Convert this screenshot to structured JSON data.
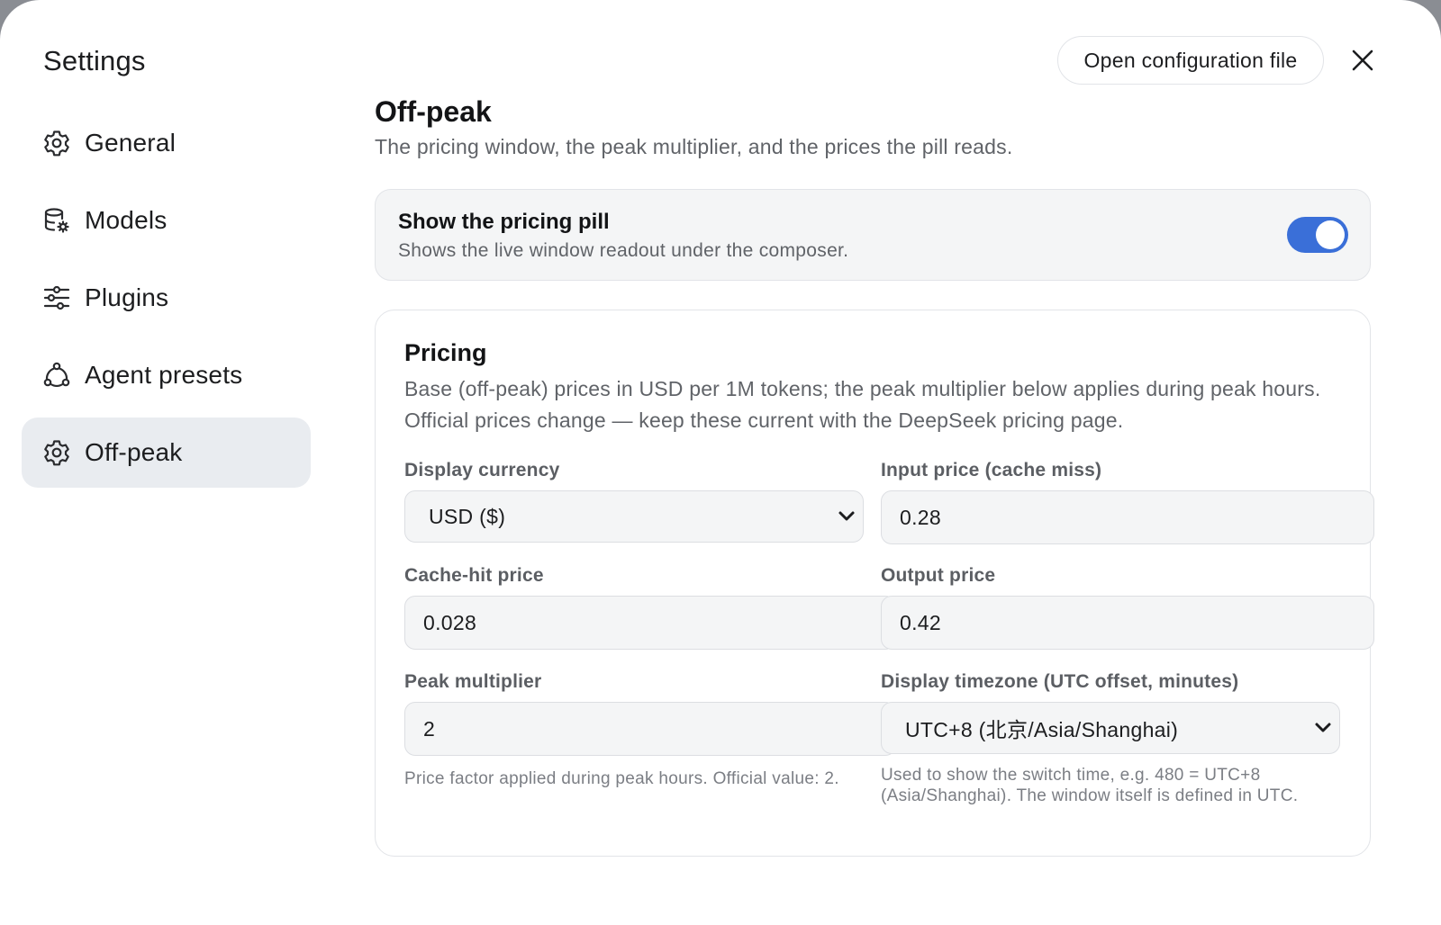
{
  "dialog": {
    "title": "Settings",
    "open_config_label": "Open configuration file",
    "close_icon": "close-icon"
  },
  "sidebar": {
    "items": [
      {
        "label": "General",
        "icon": "gear-icon",
        "active": false
      },
      {
        "label": "Models",
        "icon": "database-gear-icon",
        "active": false
      },
      {
        "label": "Plugins",
        "icon": "sliders-icon",
        "active": false
      },
      {
        "label": "Agent presets",
        "icon": "nodes-icon",
        "active": false
      },
      {
        "label": "Off-peak",
        "icon": "gear-icon",
        "active": true
      }
    ]
  },
  "main": {
    "title": "Off-peak",
    "subtitle": "The pricing window, the peak multiplier, and the prices the pill reads.",
    "pill_toggle": {
      "title": "Show the pricing pill",
      "description": "Shows the live window readout under the composer.",
      "on": true
    },
    "pricing": {
      "title": "Pricing",
      "description": "Base (off-peak) prices in USD per 1M tokens; the peak multiplier below applies during peak hours. Official prices change — keep these current with the DeepSeek pricing page.",
      "fields": {
        "display_currency": {
          "label": "Display currency",
          "value": "USD ($)"
        },
        "input_price": {
          "label": "Input price (cache miss)",
          "value": "0.28"
        },
        "cache_hit_price": {
          "label": "Cache-hit price",
          "value": "0.028"
        },
        "output_price": {
          "label": "Output price",
          "value": "0.42"
        },
        "peak_multiplier": {
          "label": "Peak multiplier",
          "value": "2",
          "help": "Price factor applied during peak hours. Official value: 2."
        },
        "display_timezone": {
          "label": "Display timezone (UTC offset, minutes)",
          "value": "UTC+8 (北京/Asia/Shanghai)",
          "help": "Used to show the switch time, e.g. 480 = UTC+8 (Asia/Shanghai). The window itself is defined in UTC."
        }
      }
    }
  },
  "colors": {
    "accent": "#3a6fd8",
    "active_nav_bg": "#e9ecf0",
    "field_bg": "#f4f5f6"
  }
}
